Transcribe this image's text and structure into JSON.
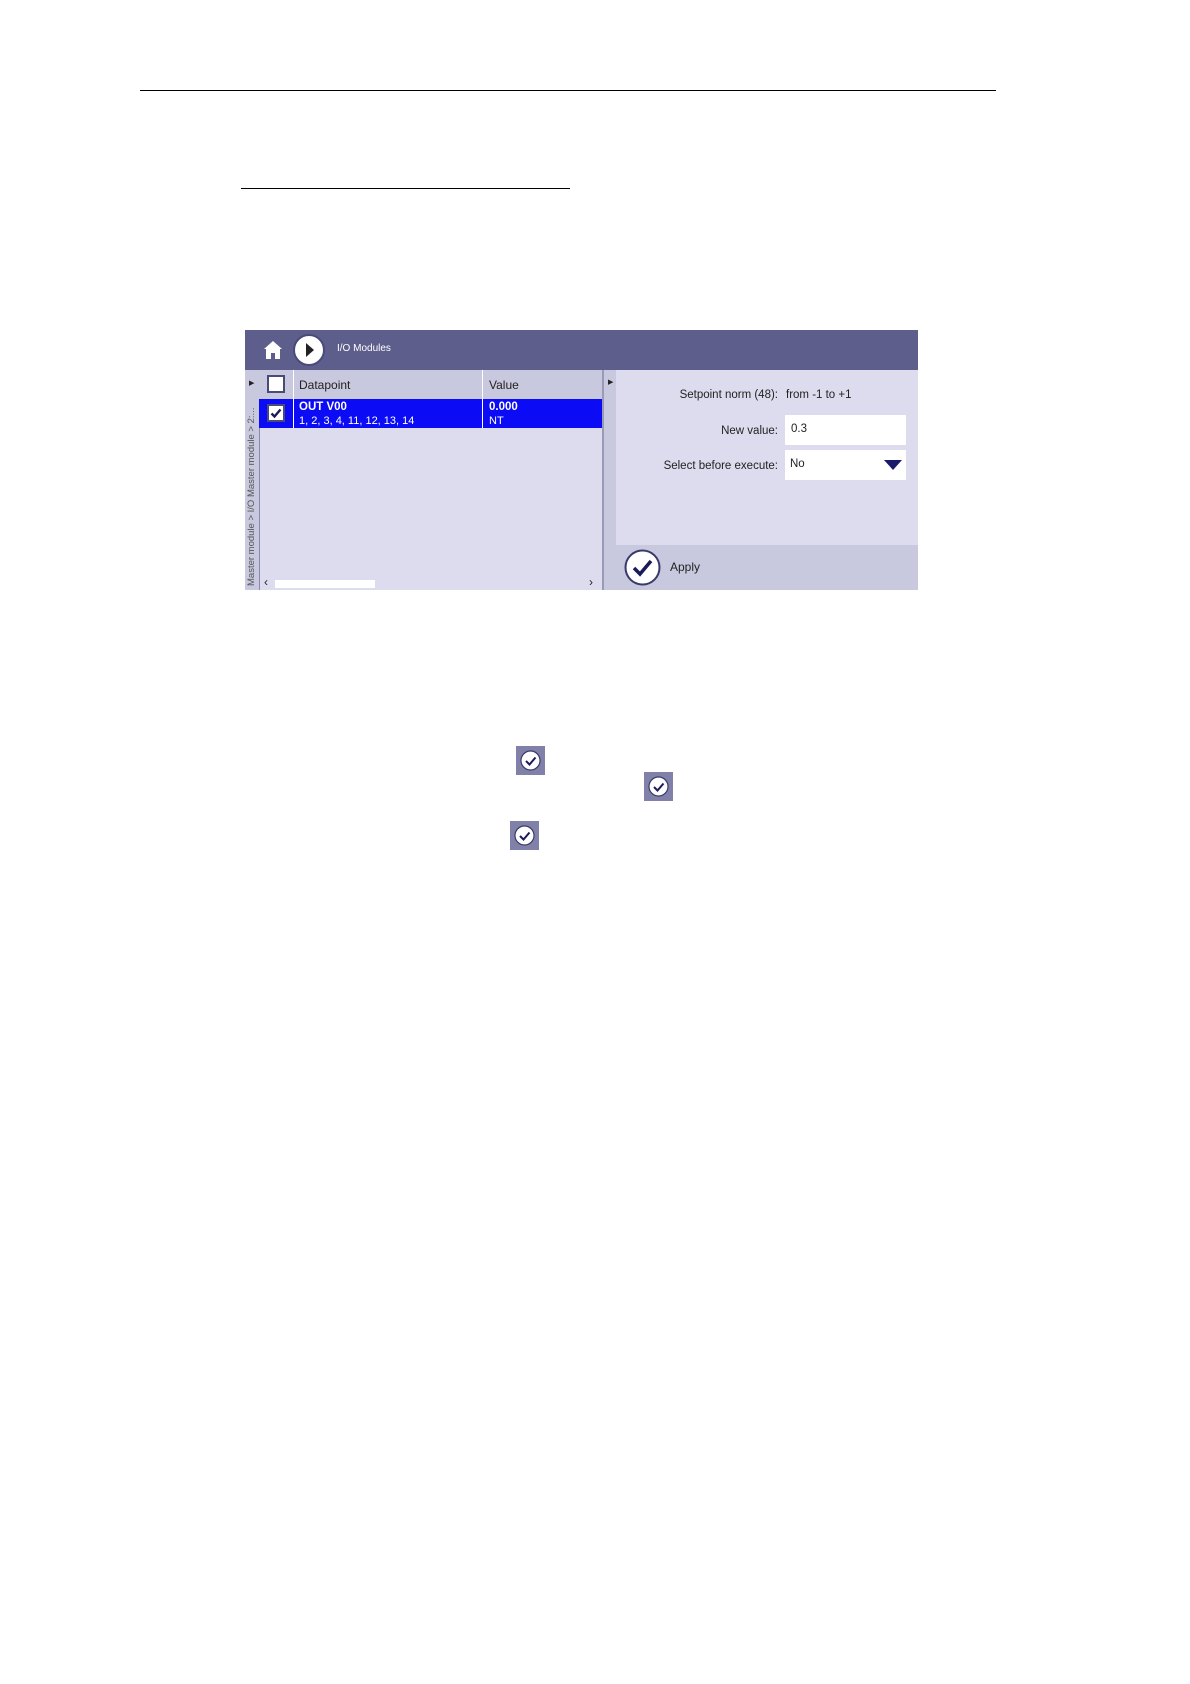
{
  "screenshot": {
    "breadcrumb": "I/O Modules",
    "side_path": "Master module > I/O Master module > 2:...",
    "table": {
      "headers": [
        "Datapoint",
        "Value"
      ],
      "rows": [
        {
          "name": "OUT V00",
          "terminals": "1, 2, 3, 4, 11, 12, 13, 14",
          "value": "0.000",
          "quality": "NT",
          "selected": true
        }
      ]
    },
    "form": {
      "setpoint_label": "Setpoint norm (48):",
      "setpoint_range": "from -1 to +1",
      "new_value_label": "New value:",
      "new_value": "0.3",
      "select_label": "Select before execute:",
      "select_value": "No"
    },
    "apply_label": "Apply"
  },
  "colors": {
    "topbar": "#5e5e8c",
    "panel": "#dcdcee",
    "selected_row": "#0b0bf5",
    "icon_bg": "#8080a8"
  },
  "icons": [
    "home-icon",
    "forward-icon",
    "checkmark-icon",
    "dropdown-caret-icon",
    "apply-check-icon"
  ]
}
